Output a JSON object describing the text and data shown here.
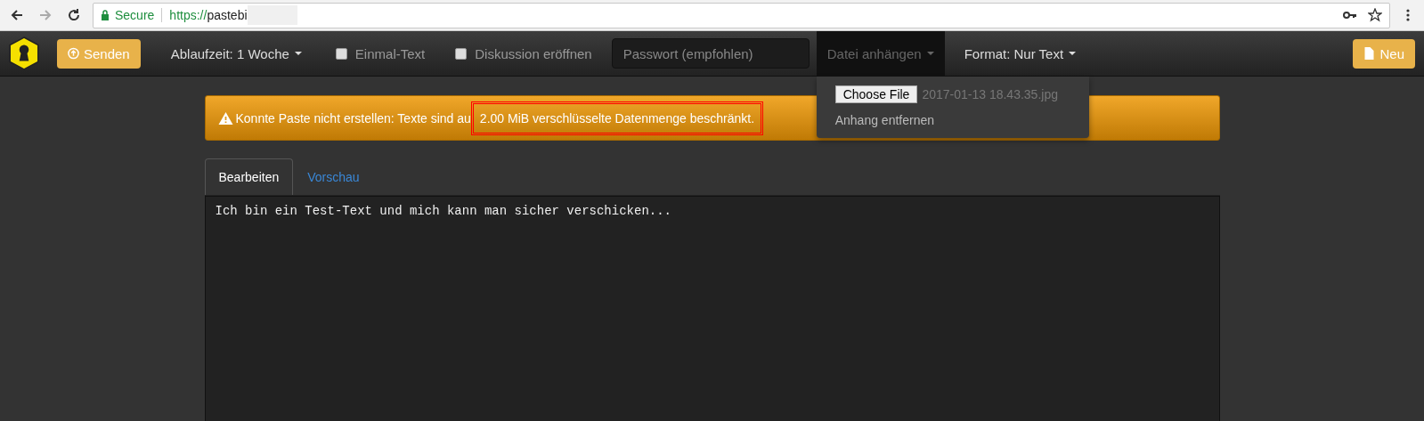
{
  "browser": {
    "secure_label": "Secure",
    "url_scheme": "https://",
    "url_host": "pastebi"
  },
  "navbar": {
    "send_button": "Senden",
    "expiry": "Ablaufzeit: 1 Woche",
    "checkboxes": [
      {
        "label": "Einmal-Text",
        "checked": false
      },
      {
        "label": "Diskussion eröffnen",
        "checked": false
      }
    ],
    "password": {
      "placeholder": "Passwort (empfohlen)"
    },
    "attach": {
      "label": "Datei anhängen",
      "expanded": true,
      "choose_button": "Choose File",
      "file_name": "2017-01-13 18.43.35.jpg",
      "remove": "Anhang entfernen"
    },
    "format": "Format: Nur Text",
    "new_button": "Neu"
  },
  "alert": {
    "text": "Konnte Paste nicht erstellen: Texte sind au",
    "highlighted": "2.00 MiB verschlüsselte Datenmenge beschränkt."
  },
  "tabs": [
    {
      "label": "Bearbeiten",
      "selected": true
    },
    {
      "label": "Vorschau",
      "selected": false
    }
  ],
  "editor": {
    "value": "Ich bin ein Test-Text und mich kann man sicher verschicken..."
  }
}
